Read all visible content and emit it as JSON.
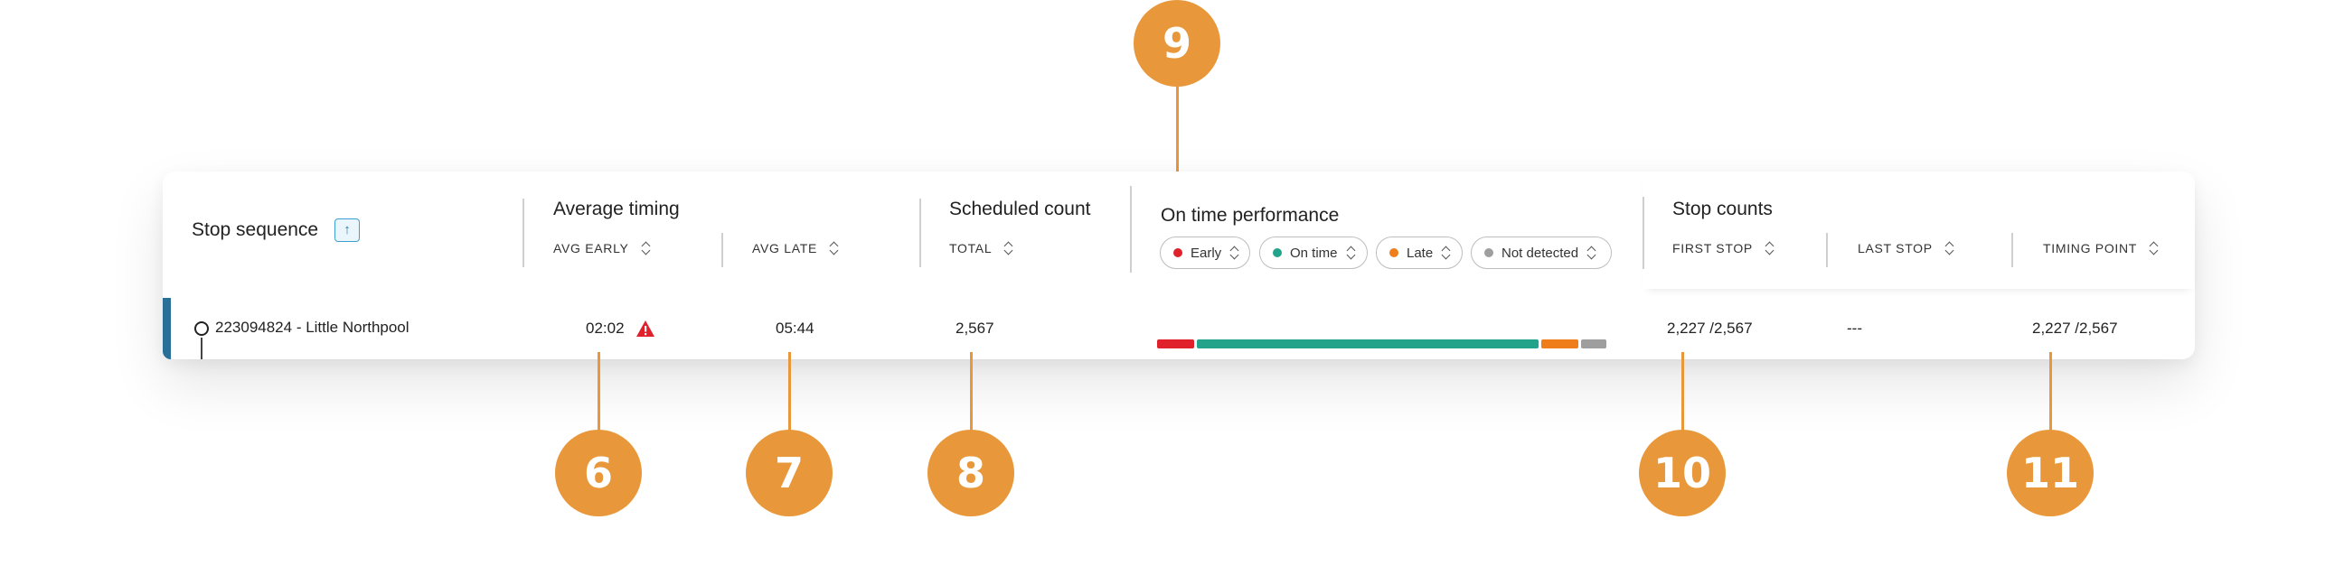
{
  "table": {
    "stop_sequence": {
      "title": "Stop sequence",
      "sort_icon": "arrow-up-icon",
      "sort_glyph": "↑"
    },
    "average_timing": {
      "title": "Average timing",
      "avg_early": "AVG EARLY",
      "avg_late": "AVG LATE"
    },
    "scheduled_count": {
      "title": "Scheduled count",
      "total": "TOTAL"
    },
    "on_time_performance": {
      "title": "On time performance",
      "filters": [
        {
          "label": "Early",
          "color": "#e0202b"
        },
        {
          "label": "On time",
          "color": "#23a48a"
        },
        {
          "label": "Late",
          "color": "#ef7d1a"
        },
        {
          "label": "Not detected",
          "color": "#9e9e9e"
        }
      ]
    },
    "stop_counts": {
      "title": "Stop counts",
      "first_stop": "FIRST STOP",
      "last_stop": "LAST STOP",
      "timing_point": "TIMING POINT"
    }
  },
  "row": {
    "stop": "223094824 - Little Northpool",
    "avg_early": "02:02",
    "avg_early_icon": "warning-icon",
    "avg_late": "05:44",
    "scheduled_total": "2,567",
    "performance": {
      "early": 2.227,
      "on_time": 20.5,
      "late": 2.227,
      "not_detected": 1.5
    },
    "first_stop": "2,227 /2,567",
    "last_stop": "---",
    "timing_point": "2,227 /2,567"
  },
  "callouts": [
    "9",
    "6",
    "7",
    "8",
    "10",
    "11"
  ],
  "colors": {
    "accent_row": "#2a6f97",
    "callout": "#e8983a"
  }
}
